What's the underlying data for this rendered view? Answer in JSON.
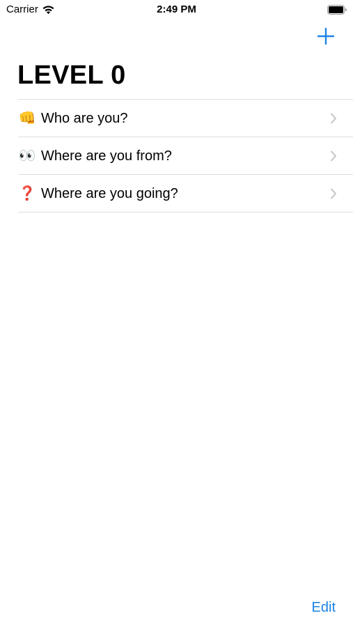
{
  "status_bar": {
    "carrier": "Carrier",
    "time": "2:49 PM",
    "wifi_icon": "wifi-icon",
    "battery_icon": "battery-icon"
  },
  "nav": {
    "add_icon": "plus-icon",
    "title": "LEVEL 0"
  },
  "list": {
    "items": [
      {
        "emoji": "👊",
        "label": "Who are you?"
      },
      {
        "emoji": "👀",
        "label": "Where are you from?"
      },
      {
        "emoji": "❓",
        "label": "Where are you going?"
      }
    ]
  },
  "toolbar": {
    "edit_label": "Edit"
  },
  "colors": {
    "accent": "#1a82e6",
    "separator": "#dedee3",
    "chevron": "#c4c4c7"
  }
}
